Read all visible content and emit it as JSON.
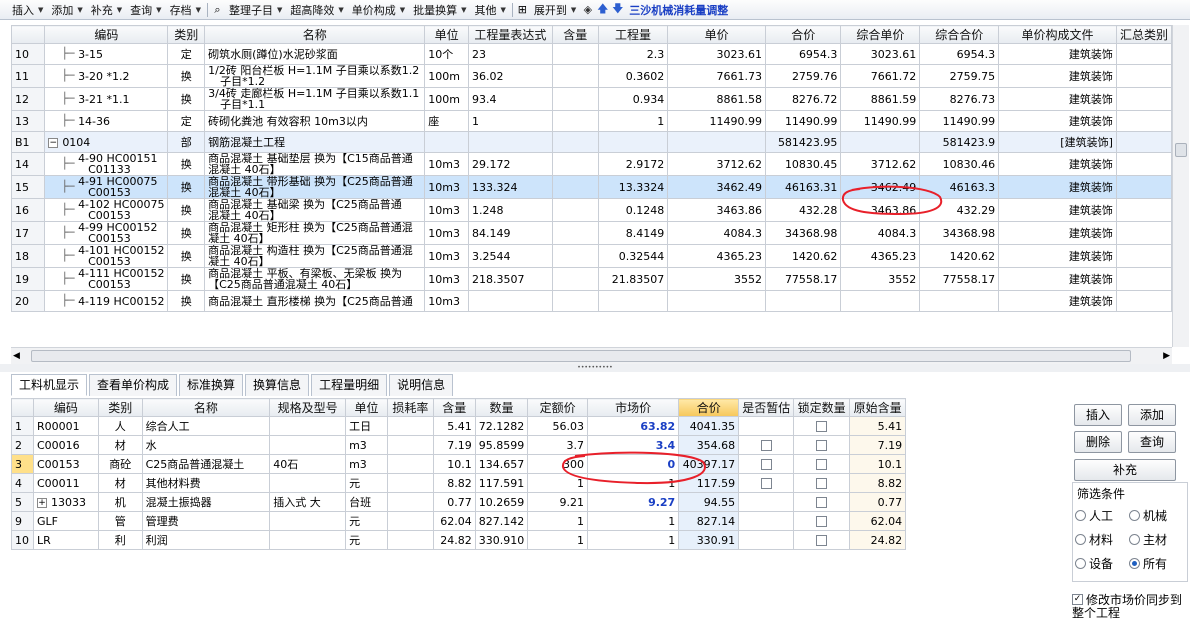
{
  "toolbar": {
    "items": [
      {
        "label": "插入",
        "dd": true
      },
      {
        "label": "添加",
        "dd": true
      },
      {
        "label": "补充",
        "dd": true
      },
      {
        "label": "查询",
        "dd": true
      },
      {
        "label": "存档",
        "dd": true
      },
      {
        "label": "整理子目",
        "dd": true
      },
      {
        "label": "超高降效",
        "dd": true
      },
      {
        "label": "单价构成",
        "dd": true
      },
      {
        "label": "批量换算",
        "dd": true
      },
      {
        "label": "其他",
        "dd": true
      },
      {
        "label": "展开到",
        "dd": true
      }
    ],
    "special": "三沙机械消耗量调整"
  },
  "top_grid": {
    "headers": [
      "",
      "编码",
      "类别",
      "名称",
      "单位",
      "工程量表达式",
      "含量",
      "工程量",
      "单价",
      "合价",
      "综合单价",
      "综合合价",
      "单价构成文件",
      "汇总类别"
    ],
    "rows": [
      {
        "rn": "10",
        "code": "3-15",
        "type": "定",
        "name": "砌筑水厕(蹲位)水泥砂浆面",
        "unit": "10个",
        "expr": "23",
        "content": "",
        "qty": "2.3",
        "price": "3023.61",
        "total": "6954.3",
        "cprice": "3023.61",
        "ctotal": "6954.3",
        "file": "建筑装饰",
        "sum": ""
      },
      {
        "rn": "11",
        "code": "3-20 *1.2",
        "type": "换",
        "name": "1/2砖 阳台栏板 H=1.1M 子目乘以系数1.2",
        "name2": "子目*1.2",
        "unit": "100m",
        "expr": "36.02",
        "content": "",
        "qty": "0.3602",
        "price": "7661.73",
        "total": "2759.76",
        "cprice": "7661.72",
        "ctotal": "2759.75",
        "file": "建筑装饰",
        "sum": ""
      },
      {
        "rn": "12",
        "code": "3-21 *1.1",
        "type": "换",
        "name": "3/4砖 走廊栏板 H=1.1M 子目乘以系数1.1",
        "name2": "子目*1.1",
        "unit": "100m",
        "expr": "93.4",
        "content": "",
        "qty": "0.934",
        "price": "8861.58",
        "total": "8276.72",
        "cprice": "8861.59",
        "ctotal": "8276.73",
        "file": "建筑装饰",
        "sum": ""
      },
      {
        "rn": "13",
        "code": "14-36",
        "type": "定",
        "name": "砖砌化粪池 有效容积 10m3以内",
        "unit": "座",
        "expr": "1",
        "content": "",
        "qty": "1",
        "price": "11490.99",
        "total": "11490.99",
        "cprice": "11490.99",
        "ctotal": "11490.99",
        "file": "建筑装饰",
        "sum": ""
      },
      {
        "rn": "B1",
        "code": "0104",
        "type": "部",
        "name": "钢筋混凝土工程",
        "unit": "",
        "expr": "",
        "content": "",
        "qty": "",
        "price": "",
        "total": "581423.95",
        "cprice": "",
        "ctotal": "581423.9",
        "file": "[建筑装饰]",
        "sum": "",
        "group": true
      },
      {
        "rn": "14",
        "code": "4-90 HC00151",
        "code2": "C01133",
        "type": "换",
        "name": "商品混凝土 基础垫层 换为【C15商品普通",
        "name2": "混凝土 40石】",
        "unit": "10m3",
        "expr": "29.172",
        "content": "",
        "qty": "2.9172",
        "price": "3712.62",
        "total": "10830.45",
        "cprice": "3712.62",
        "ctotal": "10830.46",
        "file": "建筑装饰",
        "sum": ""
      },
      {
        "rn": "15",
        "code": "4-91 HC00075",
        "code2": "C00153",
        "type": "换",
        "name": "商品混凝土 带形基础 换为【C25商品普通",
        "name2": "混凝土 40石】",
        "unit": "10m3",
        "expr": "133.324",
        "content": "",
        "qty": "13.3324",
        "price": "3462.49",
        "total": "46163.31",
        "cprice": "3462.49",
        "ctotal": "46163.3",
        "file": "建筑装饰",
        "sum": "",
        "selected": true
      },
      {
        "rn": "16",
        "code": "4-102 HC00075",
        "code2": "C00153",
        "type": "换",
        "name": "商品混凝土 基础梁  换为【C25商品普通",
        "name2": "混凝土 40石】",
        "unit": "10m3",
        "expr": "1.248",
        "content": "",
        "qty": "0.1248",
        "price": "3463.86",
        "total": "432.28",
        "cprice": "3463.86",
        "ctotal": "432.29",
        "file": "建筑装饰",
        "sum": ""
      },
      {
        "rn": "17",
        "code": "4-99 HC00152",
        "code2": "C00153",
        "type": "换",
        "name": "商品混凝土 矩形柱 换为【C25商品普通混",
        "name2": "凝土 40石】",
        "unit": "10m3",
        "expr": "84.149",
        "content": "",
        "qty": "8.4149",
        "price": "4084.3",
        "total": "34368.98",
        "cprice": "4084.3",
        "ctotal": "34368.98",
        "file": "建筑装饰",
        "sum": ""
      },
      {
        "rn": "18",
        "code": "4-101 HC00152",
        "code2": "C00153",
        "type": "换",
        "name": "商品混凝土 构造柱 换为【C25商品普通混",
        "name2": "凝土 40石】",
        "unit": "10m3",
        "expr": "3.2544",
        "content": "",
        "qty": "0.32544",
        "price": "4365.23",
        "total": "1420.62",
        "cprice": "4365.23",
        "ctotal": "1420.62",
        "file": "建筑装饰",
        "sum": ""
      },
      {
        "rn": "19",
        "code": "4-111 HC00152",
        "code2": "C00153",
        "type": "换",
        "name": "商品混凝土 平板、有梁板、无梁板 换为",
        "name2": "【C25商品普通混凝土 40石】",
        "unit": "10m3",
        "expr": "218.3507",
        "content": "",
        "qty": "21.83507",
        "price": "3552",
        "total": "77558.17",
        "cprice": "3552",
        "ctotal": "77558.17",
        "file": "建筑装饰",
        "sum": ""
      },
      {
        "rn": "20",
        "code": "4-119 HC00152",
        "code2": "",
        "type": "换",
        "name": "商品混凝土 直形楼梯 换为【C25商品普通",
        "name2": "",
        "unit": "10m3",
        "expr": "",
        "content": "",
        "qty": "",
        "price": "",
        "total": "",
        "cprice": "",
        "ctotal": "",
        "file": "建筑装饰",
        "sum": "",
        "partial": true
      }
    ]
  },
  "tabs": [
    "工料机显示",
    "查看单价构成",
    "标准换算",
    "换算信息",
    "工程量明细",
    "说明信息"
  ],
  "bottom_grid": {
    "headers": [
      "",
      "编码",
      "类别",
      "名称",
      "规格及型号",
      "单位",
      "损耗率",
      "含量",
      "数量",
      "定额价",
      "市场价",
      "合价",
      "是否暂估",
      "锁定数量",
      "原始含量"
    ],
    "rows": [
      {
        "rn": "1",
        "code": "R00001",
        "type": "人",
        "name": "综合人工",
        "spec": "",
        "unit": "工日",
        "loss": "",
        "content": "5.41",
        "qty": "72.1282",
        "quota": "56.03",
        "market": "63.82",
        "mblue": true,
        "total": "4041.35",
        "est": false,
        "lock": true,
        "orig": "5.41"
      },
      {
        "rn": "2",
        "code": "C00016",
        "type": "材",
        "name": "水",
        "spec": "",
        "unit": "m3",
        "loss": "",
        "content": "7.19",
        "qty": "95.8599",
        "quota": "3.7",
        "market": "3.4",
        "mblue": true,
        "total": "354.68",
        "est": true,
        "lock": true,
        "orig": "7.19"
      },
      {
        "rn": "3",
        "code": "C00153",
        "type": "商砼",
        "name": "C25商品普通混凝土",
        "spec": "40石",
        "unit": "m3",
        "loss": "",
        "content": "10.1",
        "qty": "134.657",
        "quota": "300",
        "market": "0",
        "mblue": true,
        "total": "40397.17",
        "est": true,
        "lock": true,
        "orig": "10.1"
      },
      {
        "rn": "4",
        "code": "C00011",
        "type": "材",
        "name": "其他材料费",
        "spec": "",
        "unit": "元",
        "loss": "",
        "content": "8.82",
        "qty": "117.591",
        "quota": "1",
        "market": "1",
        "mblue": false,
        "total": "117.59",
        "est": true,
        "lock": true,
        "orig": "8.82"
      },
      {
        "rn": "5",
        "code": "13033",
        "type": "机",
        "name": "混凝土振捣器",
        "spec": "插入式 大",
        "unit": "台班",
        "loss": "",
        "content": "0.77",
        "qty": "10.2659",
        "quota": "9.21",
        "market": "9.27",
        "mblue": true,
        "total": "94.55",
        "est": false,
        "lock": true,
        "orig": "0.77",
        "expand": true
      },
      {
        "rn": "9",
        "code": "GLF",
        "type": "管",
        "name": "管理费",
        "spec": "",
        "unit": "元",
        "loss": "",
        "content": "62.04",
        "qty": "827.142",
        "quota": "1",
        "market": "1",
        "mblue": false,
        "total": "827.14",
        "est": false,
        "lock": true,
        "orig": "62.04"
      },
      {
        "rn": "10",
        "code": "LR",
        "type": "利",
        "name": "利润",
        "spec": "",
        "unit": "元",
        "loss": "",
        "content": "24.82",
        "qty": "330.910",
        "quota": "1",
        "market": "1",
        "mblue": false,
        "total": "330.91",
        "est": false,
        "lock": true,
        "orig": "24.82"
      }
    ]
  },
  "right_panel": {
    "insert": "插入",
    "add": "添加",
    "delete": "删除",
    "query": "查询",
    "supplement": "补充",
    "filter_title": "筛选条件",
    "options": [
      "人工",
      "机械",
      "材料",
      "主材",
      "设备",
      "所有"
    ],
    "selected": "所有",
    "sync_label": "修改市场价同步到整个工程"
  },
  "colors": {
    "header": "#e7ebf0",
    "selected_row": "#cde4fb",
    "group_row": "#eaf1fb",
    "blue_text": "#1a3fc4",
    "annotation": "#e8202a"
  }
}
